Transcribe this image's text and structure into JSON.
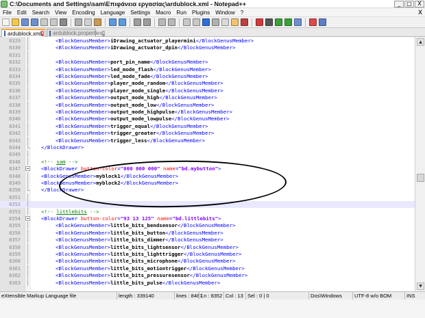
{
  "window": {
    "title": "C:\\Documents and Settings\\sam\\Επιφάνεια εργασίας\\ardublock.xml - Notepad++",
    "controls": [
      "_",
      "□",
      "X"
    ]
  },
  "menu": {
    "items": [
      "File",
      "Edit",
      "Search",
      "View",
      "Encoding",
      "Language",
      "Settings",
      "Macro",
      "Run",
      "Plugins",
      "Window",
      "?"
    ],
    "close": "X"
  },
  "toolbar": {
    "icons": [
      {
        "name": "new-file-icon",
        "color": "#f4f4f4"
      },
      {
        "name": "open-file-icon",
        "color": "#f2c94c"
      },
      {
        "name": "save-icon",
        "color": "#6f8fd1"
      },
      {
        "name": "save-all-icon",
        "color": "#6f8fd1"
      },
      {
        "name": "close-icon",
        "color": "#c9c9c9"
      },
      {
        "name": "close-all-icon",
        "color": "#c9c9c9"
      },
      {
        "name": "print-icon",
        "color": "#8a8a8a"
      },
      {
        "sep": true
      },
      {
        "name": "cut-icon",
        "color": "#b0b0b0"
      },
      {
        "name": "copy-icon",
        "color": "#d0d0d0"
      },
      {
        "name": "paste-icon",
        "color": "#c79a56"
      },
      {
        "sep": true
      },
      {
        "name": "undo-icon",
        "color": "#5b9be0"
      },
      {
        "name": "redo-icon",
        "color": "#5b9be0"
      },
      {
        "sep": true
      },
      {
        "name": "find-icon",
        "color": "#9e9e9e"
      },
      {
        "name": "replace-icon",
        "color": "#9e9e9e"
      },
      {
        "sep": true
      },
      {
        "name": "zoom-in-icon",
        "color": "#b8b8b8"
      },
      {
        "name": "zoom-out-icon",
        "color": "#b8b8b8"
      },
      {
        "sep": true
      },
      {
        "name": "sync-scroll-icon",
        "color": "#c8c8c8"
      },
      {
        "name": "wrap-icon",
        "color": "#c8c8c8"
      },
      {
        "name": "all-chars-icon",
        "color": "#2b6fd6"
      },
      {
        "name": "indent-guide-icon",
        "color": "#b0b0b0"
      },
      {
        "name": "user-lang-icon",
        "color": "#d9d9d9"
      },
      {
        "name": "doc-map-icon",
        "color": "#f0c36d"
      },
      {
        "name": "function-list-icon",
        "color": "#c04040"
      },
      {
        "sep": true
      },
      {
        "name": "record-macro-icon",
        "color": "#d33a3a"
      },
      {
        "name": "stop-macro-icon",
        "color": "#555555"
      },
      {
        "name": "play-macro-icon",
        "color": "#3aa03a"
      },
      {
        "name": "play-multiple-icon",
        "color": "#3aa03a"
      },
      {
        "name": "save-macro-icon",
        "color": "#6f8fd1"
      },
      {
        "sep": true
      },
      {
        "name": "spellcheck-icon",
        "color": "#e04848"
      },
      {
        "name": "plugin-icon",
        "color": "#5b7fc7"
      }
    ]
  },
  "tabs": [
    {
      "label": "ardublock.xml",
      "active": true
    },
    {
      "label": "ardublock.properties",
      "active": false
    }
  ],
  "editor": {
    "current_line": "8352",
    "lines": [
      {
        "n": "8329",
        "fold": "line",
        "indent": 2,
        "kind": "member",
        "text": "iDrawing_actuator_playermini"
      },
      {
        "n": "8330",
        "fold": "line",
        "indent": 2,
        "kind": "member",
        "text": "iDrawing_actuator_dpin"
      },
      {
        "n": "8331",
        "fold": "line",
        "indent": 0,
        "kind": "blank"
      },
      {
        "n": "8332",
        "fold": "line",
        "indent": 2,
        "kind": "member",
        "text": "port_pin_name"
      },
      {
        "n": "8333",
        "fold": "line",
        "indent": 2,
        "kind": "member",
        "text": "led_mode_flash"
      },
      {
        "n": "8334",
        "fold": "line",
        "indent": 2,
        "kind": "member",
        "text": "led_mode_fade"
      },
      {
        "n": "8335",
        "fold": "line",
        "indent": 2,
        "kind": "member",
        "text": "player_mode_random"
      },
      {
        "n": "8336",
        "fold": "line",
        "indent": 2,
        "kind": "member",
        "text": "player_mode_single"
      },
      {
        "n": "8337",
        "fold": "line",
        "indent": 2,
        "kind": "member",
        "text": "output_mode_high"
      },
      {
        "n": "8338",
        "fold": "line",
        "indent": 2,
        "kind": "member",
        "text": "output_mode_low"
      },
      {
        "n": "8339",
        "fold": "line",
        "indent": 2,
        "kind": "member",
        "text": "output_mode_highpulse"
      },
      {
        "n": "8340",
        "fold": "line",
        "indent": 2,
        "kind": "member",
        "text": "output_mode_lowpulse"
      },
      {
        "n": "8341",
        "fold": "line",
        "indent": 2,
        "kind": "member",
        "text": "trigger_equal"
      },
      {
        "n": "8342",
        "fold": "line",
        "indent": 2,
        "kind": "member",
        "text": "trigger_greater"
      },
      {
        "n": "8343",
        "fold": "line",
        "indent": 2,
        "kind": "member",
        "text": "trigger_less"
      },
      {
        "n": "8344",
        "fold": "end",
        "indent": 1,
        "kind": "close_drawer"
      },
      {
        "n": "8345",
        "fold": "line",
        "indent": 0,
        "kind": "blank"
      },
      {
        "n": "8346",
        "fold": "line",
        "indent": 1,
        "kind": "comment",
        "text": "sam"
      },
      {
        "n": "8347",
        "fold": "box",
        "indent": 1,
        "kind": "open_drawer",
        "color": "000 000 000",
        "name": "bd.mybutton"
      },
      {
        "n": "8348",
        "fold": "line",
        "indent": 1,
        "kind": "member",
        "text": "myblock1"
      },
      {
        "n": "8349",
        "fold": "line",
        "indent": 1,
        "kind": "member",
        "text": "myblock2"
      },
      {
        "n": "8350",
        "fold": "end",
        "indent": 1,
        "kind": "close_drawer"
      },
      {
        "n": "8351",
        "fold": "line",
        "indent": 0,
        "kind": "blank"
      },
      {
        "n": "8352",
        "fold": "line",
        "indent": 0,
        "kind": "blank"
      },
      {
        "n": "8353",
        "fold": "line",
        "indent": 1,
        "kind": "comment",
        "text": "littlebits"
      },
      {
        "n": "8354",
        "fold": "box",
        "indent": 1,
        "kind": "open_drawer",
        "color": "93 13 125",
        "name": "bd.littlebits"
      },
      {
        "n": "8355",
        "fold": "line",
        "indent": 2,
        "kind": "member",
        "text": "little_bits_bendsensor"
      },
      {
        "n": "8356",
        "fold": "line",
        "indent": 2,
        "kind": "member",
        "text": "little_bits_button"
      },
      {
        "n": "8357",
        "fold": "line",
        "indent": 2,
        "kind": "member",
        "text": "little_bits_dimmer"
      },
      {
        "n": "8358",
        "fold": "line",
        "indent": 2,
        "kind": "member",
        "text": "little_bits_lightsensor"
      },
      {
        "n": "8359",
        "fold": "line",
        "indent": 2,
        "kind": "member",
        "text": "little_bits_lighttrigger"
      },
      {
        "n": "8360",
        "fold": "line",
        "indent": 2,
        "kind": "member",
        "text": "little_bits_microphone"
      },
      {
        "n": "8361",
        "fold": "line",
        "indent": 2,
        "kind": "member",
        "text": "little_bits_motiontrigger"
      },
      {
        "n": "8362",
        "fold": "line",
        "indent": 2,
        "kind": "member",
        "text": "little_bits_pressuresensor"
      },
      {
        "n": "8363",
        "fold": "line",
        "indent": 2,
        "kind": "member",
        "text": "little_bits_pulse"
      }
    ]
  },
  "status": {
    "language": "eXtensible Markup Language file",
    "length": "length : 339140",
    "lines": "lines : 8487",
    "ln": "Ln : 8352",
    "col": "Col : 13",
    "sel": "Sel : 0 | 0",
    "eol": "Dos\\Windows",
    "encoding": "UTF-8 w/o BOM",
    "mode": "INS"
  },
  "colors": {
    "tag": "#0000ff",
    "attribute": "#ff0000",
    "attribute_value": "#8000ff",
    "comment": "#008000",
    "current_line_bg": "#e8e8ff",
    "active_tab_accent": "#f6a531"
  }
}
